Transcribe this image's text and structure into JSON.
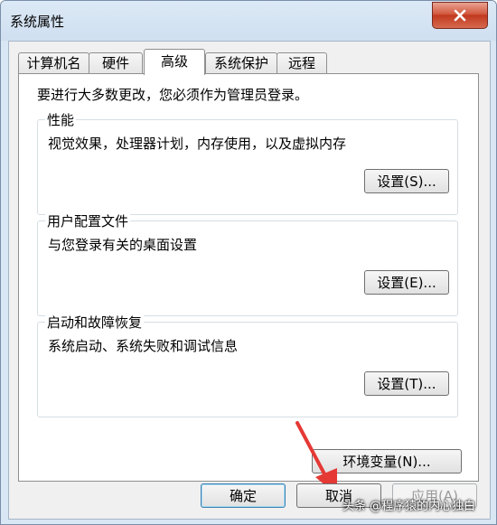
{
  "window": {
    "title": "系统属性"
  },
  "tabs": [
    {
      "label": "计算机名"
    },
    {
      "label": "硬件"
    },
    {
      "label": "高级"
    },
    {
      "label": "系统保护"
    },
    {
      "label": "远程"
    }
  ],
  "advanced": {
    "intro": "要进行大多数更改，您必须作为管理员登录。",
    "performance": {
      "title": "性能",
      "description": "视觉效果，处理器计划，内存使用，以及虚拟内存",
      "button": "设置(S)..."
    },
    "user_profiles": {
      "title": "用户配置文件",
      "description": "与您登录有关的桌面设置",
      "button": "设置(E)..."
    },
    "startup_recovery": {
      "title": "启动和故障恢复",
      "description": "系统启动、系统失败和调试信息",
      "button": "设置(T)..."
    },
    "env_vars_button": "环境变量(N)..."
  },
  "footer": {
    "ok": "确定",
    "cancel": "取消",
    "apply": "应用(A)"
  },
  "watermark": "头条 @程序猿的内心独白",
  "colors": {
    "annotation_arrow": "#e53935",
    "close_button": "#c1391f"
  }
}
